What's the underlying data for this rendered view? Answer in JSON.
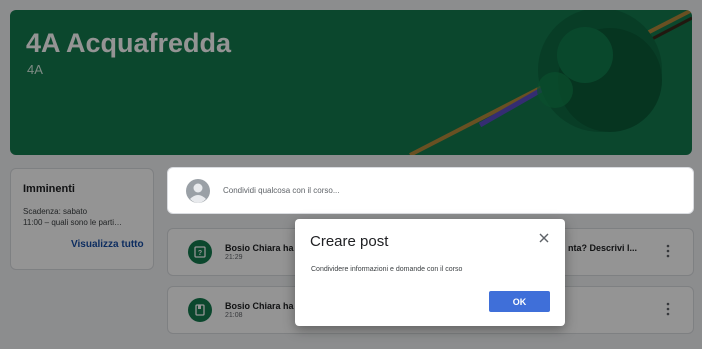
{
  "banner": {
    "title": "4A Acquafredda",
    "subtitle": "4A"
  },
  "upcoming": {
    "heading": "Imminenti",
    "due": "Scadenza: sabato",
    "item": "11:00 – quali sono le parti…",
    "view_all": "Visualizza tutto"
  },
  "share": {
    "placeholder": "Condividi qualcosa con il corso..."
  },
  "stream": [
    {
      "title": "Bosio Chiara ha",
      "time": "21:29",
      "tail": "nta? Descrivi l...",
      "icon": "question-icon"
    },
    {
      "title": "Bosio Chiara ha",
      "time": "21:08",
      "icon": "assignment-icon"
    }
  ],
  "dialog": {
    "title": "Creare post",
    "description": "Condividere informazioni e domande con il corso",
    "ok_label": "OK"
  },
  "colors": {
    "banner": "#137a4e",
    "accent": "#3f6fd9",
    "icon_bg": "#137a4e"
  }
}
